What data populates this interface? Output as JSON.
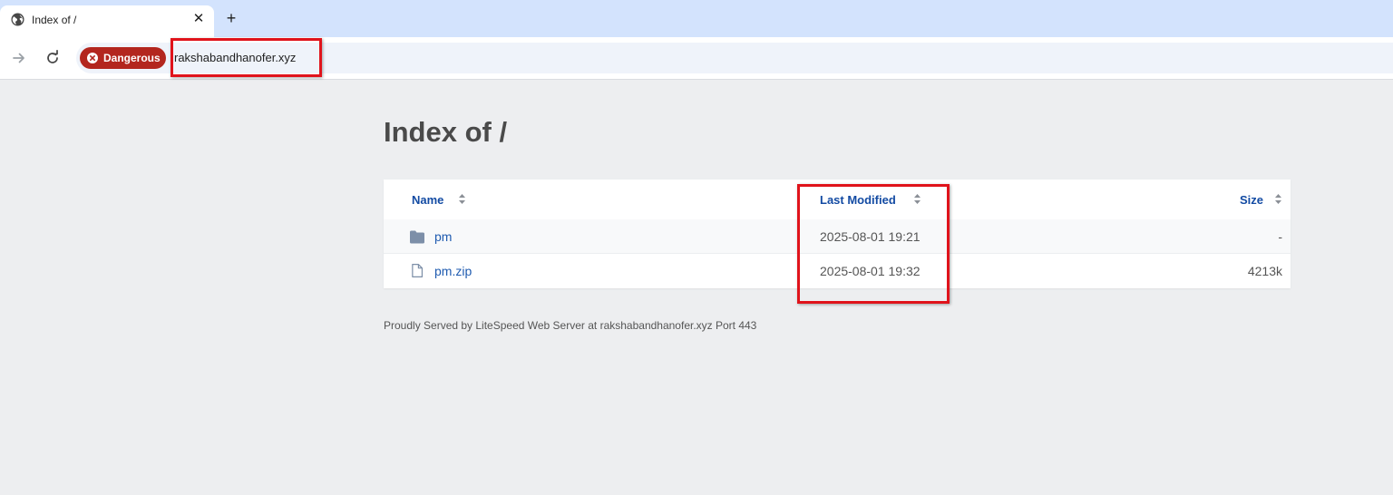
{
  "browser": {
    "tab": {
      "title": "Index of /",
      "close_glyph": "✕",
      "favicon": "globe-icon"
    },
    "new_tab_glyph": "+",
    "security_chip": {
      "label": "Dangerous",
      "color": "#b3261e"
    },
    "url": "rakshabandhanofer.xyz"
  },
  "page": {
    "title": "Index of /",
    "columns": {
      "name": "Name",
      "last_modified": "Last Modified",
      "size": "Size"
    },
    "entries": [
      {
        "name": "pm",
        "icon": "folder-icon",
        "modified": "2025-08-01 19:21",
        "size": "-"
      },
      {
        "name": "pm.zip",
        "icon": "file-icon",
        "modified": "2025-08-01 19:32",
        "size": "4213k"
      }
    ],
    "footer": "Proudly Served by LiteSpeed Web Server at rakshabandhanofer.xyz Port 443"
  },
  "colors": {
    "highlight": "#e0131b",
    "link": "#134ba3",
    "page_bg": "#edeef0",
    "tabstrip": "#d3e3fd"
  }
}
